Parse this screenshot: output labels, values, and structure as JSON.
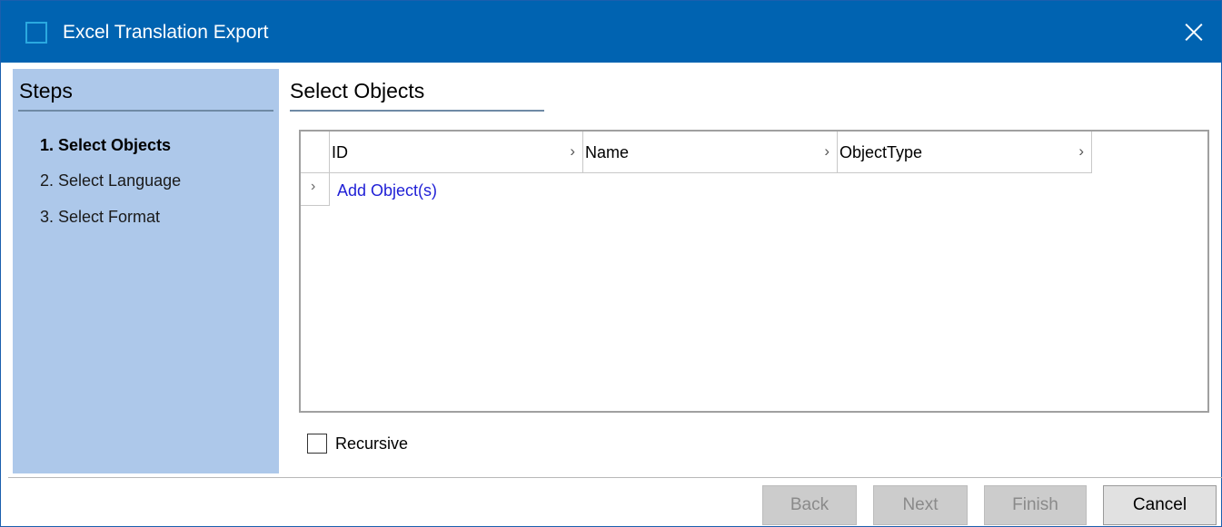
{
  "window": {
    "title": "Excel Translation Export"
  },
  "steps": {
    "header": "Steps",
    "items": [
      {
        "label": "1. Select Objects",
        "active": true
      },
      {
        "label": "2. Select Language",
        "active": false
      },
      {
        "label": "3. Select Format",
        "active": false
      }
    ]
  },
  "main": {
    "title": "Select Objects",
    "grid": {
      "columns": [
        "ID",
        "Name",
        "ObjectType"
      ],
      "add_row_label": "Add Object(s)"
    },
    "recursive": {
      "label": "Recursive",
      "checked": false
    }
  },
  "buttons": {
    "back": "Back",
    "next": "Next",
    "finish": "Finish",
    "cancel": "Cancel"
  },
  "colors": {
    "titlebar": "#0063b1",
    "steps_pane": "#adc8ea",
    "link": "#1f1fd6"
  }
}
